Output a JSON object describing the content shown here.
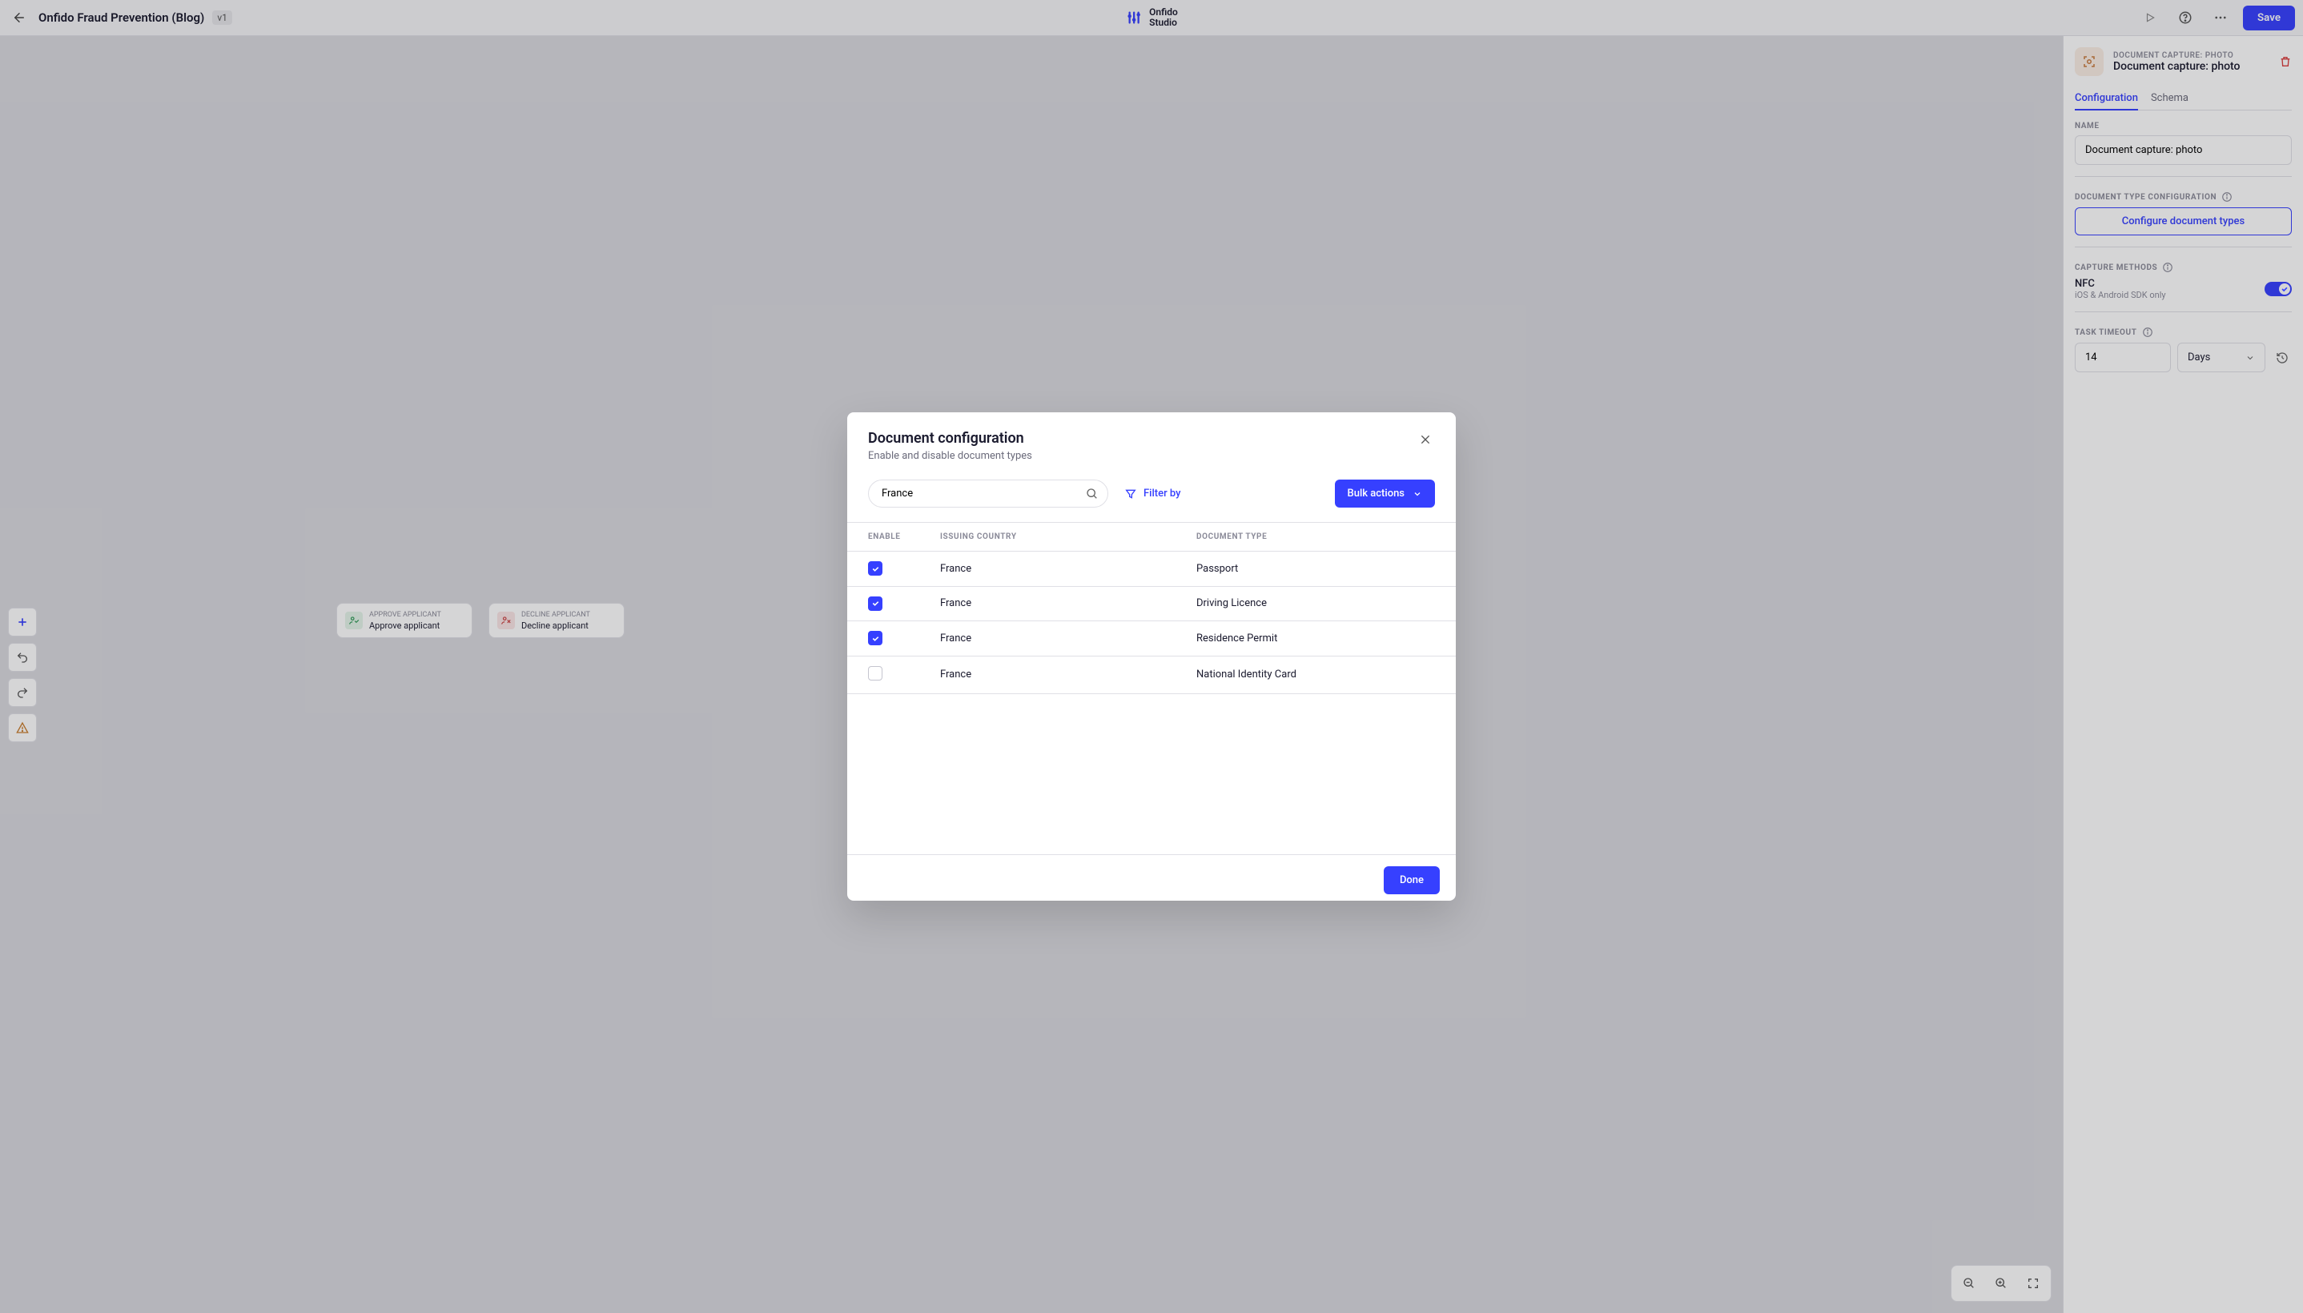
{
  "header": {
    "title": "Onfido Fraud Prevention (Blog)",
    "version": "v1",
    "brand_line1": "Onfido",
    "brand_line2": "Studio",
    "save_label": "Save"
  },
  "canvas": {
    "approve": {
      "over": "APPROVE APPLICANT",
      "label": "Approve applicant"
    },
    "decline": {
      "over": "DECLINE APPLICANT",
      "label": "Decline applicant"
    }
  },
  "sidebar": {
    "overline": "DOCUMENT CAPTURE: PHOTO",
    "title": "Document capture: photo",
    "tabs": {
      "config": "Configuration",
      "schema": "Schema"
    },
    "name_label": "NAME",
    "name_value": "Document capture: photo",
    "doc_type_label": "DOCUMENT TYPE CONFIGURATION",
    "configure_btn": "Configure document types",
    "capture_label": "CAPTURE METHODS",
    "nfc_label": "NFC",
    "nfc_sub": "iOS & Android SDK only",
    "timeout_label": "TASK TIMEOUT",
    "timeout_value": "14",
    "timeout_unit": "Days"
  },
  "modal": {
    "title": "Document configuration",
    "subtitle": "Enable and disable document types",
    "search_value": "France",
    "filter_label": "Filter by",
    "bulk_label": "Bulk actions",
    "columns": {
      "enable": "ENABLE",
      "country": "ISSUING COUNTRY",
      "type": "DOCUMENT TYPE"
    },
    "rows": [
      {
        "enabled": true,
        "country": "France",
        "type": "Passport"
      },
      {
        "enabled": true,
        "country": "France",
        "type": "Driving Licence"
      },
      {
        "enabled": true,
        "country": "France",
        "type": "Residence Permit"
      },
      {
        "enabled": false,
        "country": "France",
        "type": "National Identity Card"
      }
    ],
    "done_label": "Done"
  }
}
